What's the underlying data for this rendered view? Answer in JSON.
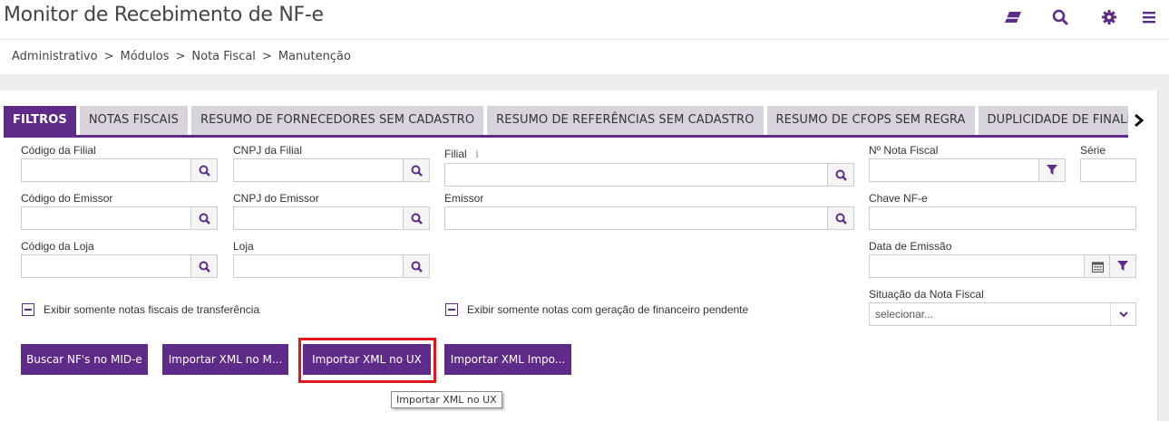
{
  "app": {
    "title": "Monitor de Recebimento de NF-e",
    "accent": "#5f2b88",
    "highlight_color": "#e0161c"
  },
  "toolbar": {
    "icons": [
      "eraser-icon",
      "search-icon",
      "gear-icon",
      "menu-icon"
    ]
  },
  "breadcrumb": {
    "items": [
      "Administrativo",
      "Módulos",
      "Nota Fiscal",
      "Manutenção"
    ],
    "separator": ">"
  },
  "tabs": [
    {
      "label": "FILTROS",
      "active": true
    },
    {
      "label": "NOTAS FISCAIS",
      "active": false
    },
    {
      "label": "RESUMO DE FORNECEDORES SEM CADASTRO",
      "active": false
    },
    {
      "label": "RESUMO DE REFERÊNCIAS SEM CADASTRO",
      "active": false
    },
    {
      "label": "RESUMO DE CFOPS SEM REGRA",
      "active": false
    },
    {
      "label": "DUPLICIDADE DE FINALIDADE DA OPERA",
      "active": false
    }
  ],
  "filters": {
    "codigo_filial": {
      "label": "Código da Filial",
      "value": ""
    },
    "cnpj_filial": {
      "label": "CNPJ da Filial",
      "value": ""
    },
    "filial": {
      "label": "Filial",
      "value": ""
    },
    "nota_fiscal": {
      "label": "Nº Nota Fiscal",
      "value": ""
    },
    "serie": {
      "label": "Série",
      "value": ""
    },
    "codigo_emissor": {
      "label": "Código do Emissor",
      "value": ""
    },
    "cnpj_emissor": {
      "label": "CNPJ do Emissor",
      "value": ""
    },
    "emissor": {
      "label": "Emissor",
      "value": ""
    },
    "chave": {
      "label": "Chave NF-e",
      "value": ""
    },
    "codigo_loja": {
      "label": "Código da Loja",
      "value": ""
    },
    "loja": {
      "label": "Loja",
      "value": ""
    },
    "data_emissao": {
      "label": "Data de Emissão",
      "value": ""
    },
    "situacao": {
      "label": "Situação da Nota Fiscal",
      "value": "selecionar..."
    }
  },
  "checkboxes": {
    "transferencia": "Exibir somente notas fiscais de transferência",
    "financeiro": "Exibir somente notas com geração de financeiro pendente"
  },
  "actions": {
    "buscar": "Buscar NF's no MID-e",
    "importar_m": "Importar XML no M...",
    "importar_ux": "Importar XML no UX",
    "importar_impo": "Importar XML Impo..."
  },
  "tooltip": "Importar XML no UX"
}
